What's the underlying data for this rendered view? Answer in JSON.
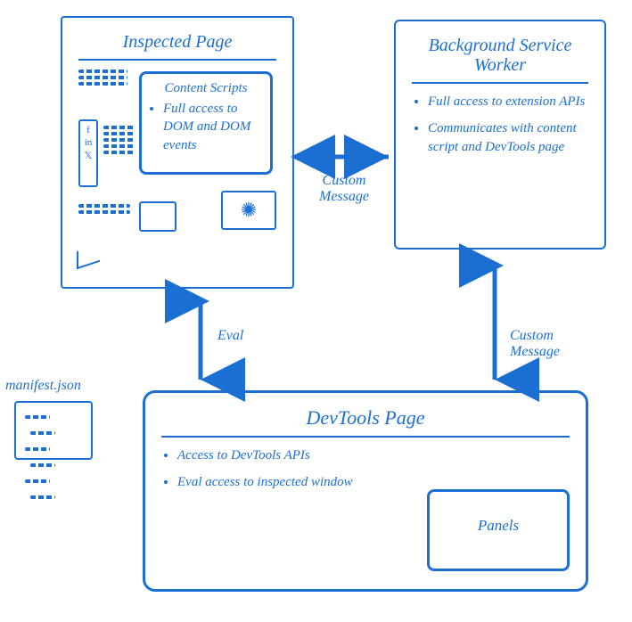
{
  "inspected": {
    "title": "Inspected Page",
    "content_scripts": {
      "title": "Content Scripts",
      "bullet": "Full access to DOM and DOM events"
    }
  },
  "background": {
    "title": "Background Service Worker",
    "bullets": [
      "Full access to extension APIs",
      "Communicates with content script and DevTools page"
    ]
  },
  "devtools": {
    "title": "DevTools Page",
    "bullets": [
      "Access to DevTools APIs",
      "Eval access to inspected window"
    ],
    "panels_label": "Panels"
  },
  "manifest": {
    "label": "manifest.json"
  },
  "arrows": {
    "custom_message_h": "Custom Message",
    "eval": "Eval",
    "custom_message_v": "Custom Message"
  }
}
